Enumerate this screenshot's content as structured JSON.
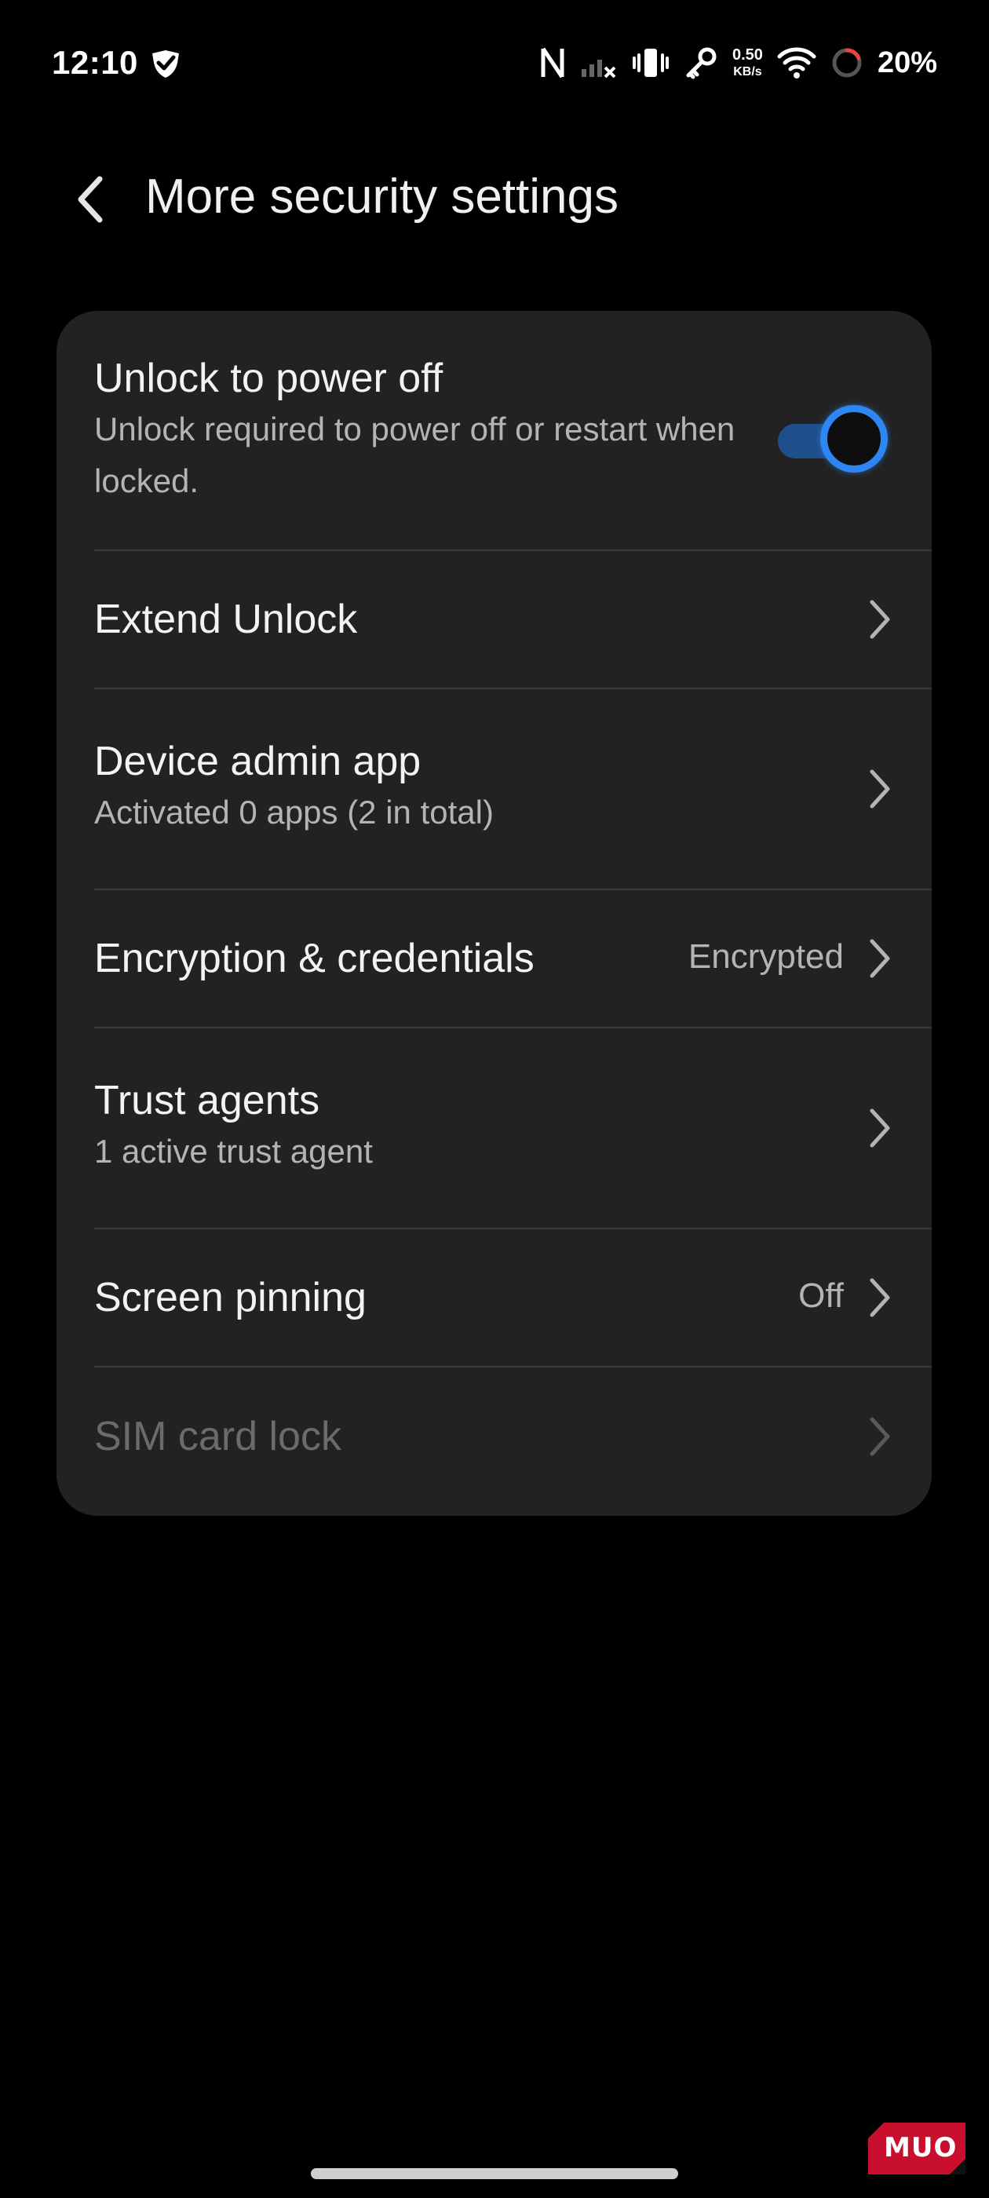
{
  "status_bar": {
    "time": "12:10",
    "net_speed_value": "0.50",
    "net_speed_unit": "KB/s",
    "battery_percent": "20%"
  },
  "header": {
    "title": "More security settings"
  },
  "rows": [
    {
      "title": "Unlock to power off",
      "subtitle": "Unlock required to power off or restart when locked.",
      "toggle_on": true
    },
    {
      "title": "Extend Unlock"
    },
    {
      "title": "Device admin app",
      "subtitle": "Activated 0 apps (2 in total)"
    },
    {
      "title": "Encryption & credentials",
      "value": "Encrypted"
    },
    {
      "title": "Trust agents",
      "subtitle": "1 active trust agent"
    },
    {
      "title": "Screen pinning",
      "value": "Off"
    },
    {
      "title": "SIM card lock",
      "disabled": true
    }
  ],
  "watermark": {
    "text": "MUO"
  },
  "colors": {
    "background": "#000000",
    "card": "#222222",
    "accent": "#2e86f2",
    "track": "#1e4f8c",
    "secondary_text": "#b4b4b4",
    "disabled_text": "#6b6b6b",
    "watermark_red": "#c8102e"
  }
}
